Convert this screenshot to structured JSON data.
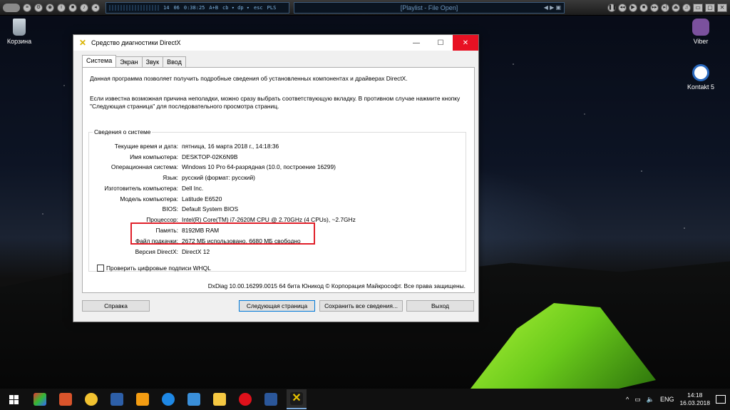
{
  "media_player": {
    "time": "14",
    "time2": "06",
    "position": "0:38:25",
    "info": "A+B",
    "extra": "cb ▾ dp ▾",
    "esc": "esc",
    "sub": "PLS",
    "playlist_title": "[Playlist - File Open]"
  },
  "desktop": {
    "icons": [
      {
        "label": "Корзина",
        "icon": "recycle-bin-icon"
      },
      {
        "label": "Viber",
        "icon": "viber-icon"
      },
      {
        "label": "Kontakt 5",
        "icon": "kontakt-icon"
      }
    ]
  },
  "window": {
    "title": "Средство диагностики DirectX",
    "tabs": [
      "Система",
      "Экран",
      "Звук",
      "Ввод"
    ],
    "intro1": "Данная программа позволяет получить подробные сведения об установленных компонентах и драйверах DirectX.",
    "intro2": "Если известна возможная причина неполадки, можно сразу выбрать соответствующую вкладку. В противном случае нажмите кнопку \"Следующая страница\" для последовательного просмотра страниц.",
    "group_title": "Сведения о системе",
    "rows": [
      {
        "label": "Текущие время и дата:",
        "value": "пятница, 16 марта 2018 г., 14:18:36"
      },
      {
        "label": "Имя компьютера:",
        "value": "DESKTOP-02K6N9B"
      },
      {
        "label": "Операционная система:",
        "value": "Windows 10 Pro 64-разрядная (10.0, построение 16299)"
      },
      {
        "label": "Язык:",
        "value": "русский (формат: русский)"
      },
      {
        "label": "Изготовитель компьютера:",
        "value": "Dell Inc."
      },
      {
        "label": "Модель компьютера:",
        "value": "Latitude E6520"
      },
      {
        "label": "BIOS:",
        "value": "Default System BIOS"
      },
      {
        "label": "Процессор:",
        "value": "Intel(R) Core(TM) i7-2620M CPU @ 2.70GHz (4 CPUs), ~2.7GHz"
      },
      {
        "label": "Память:",
        "value": "8192MB RAM"
      },
      {
        "label": "Файл подкачки:",
        "value": "2672 МБ использовано, 6680 МБ свободно"
      },
      {
        "label": "Версия DirectX:",
        "value": "DirectX 12"
      }
    ],
    "checkbox_label": "Проверить цифровые подписи WHQL",
    "copyright": "DxDiag 10.00.16299.0015 64 бита Юникод © Корпорация Майкрософт. Все права защищены.",
    "buttons": {
      "help": "Справка",
      "next": "Следующая страница",
      "save": "Сохранить все сведения...",
      "exit": "Выход"
    }
  },
  "taskbar": {
    "lang": "ENG",
    "time": "14:18",
    "date": "16.03.2018"
  }
}
